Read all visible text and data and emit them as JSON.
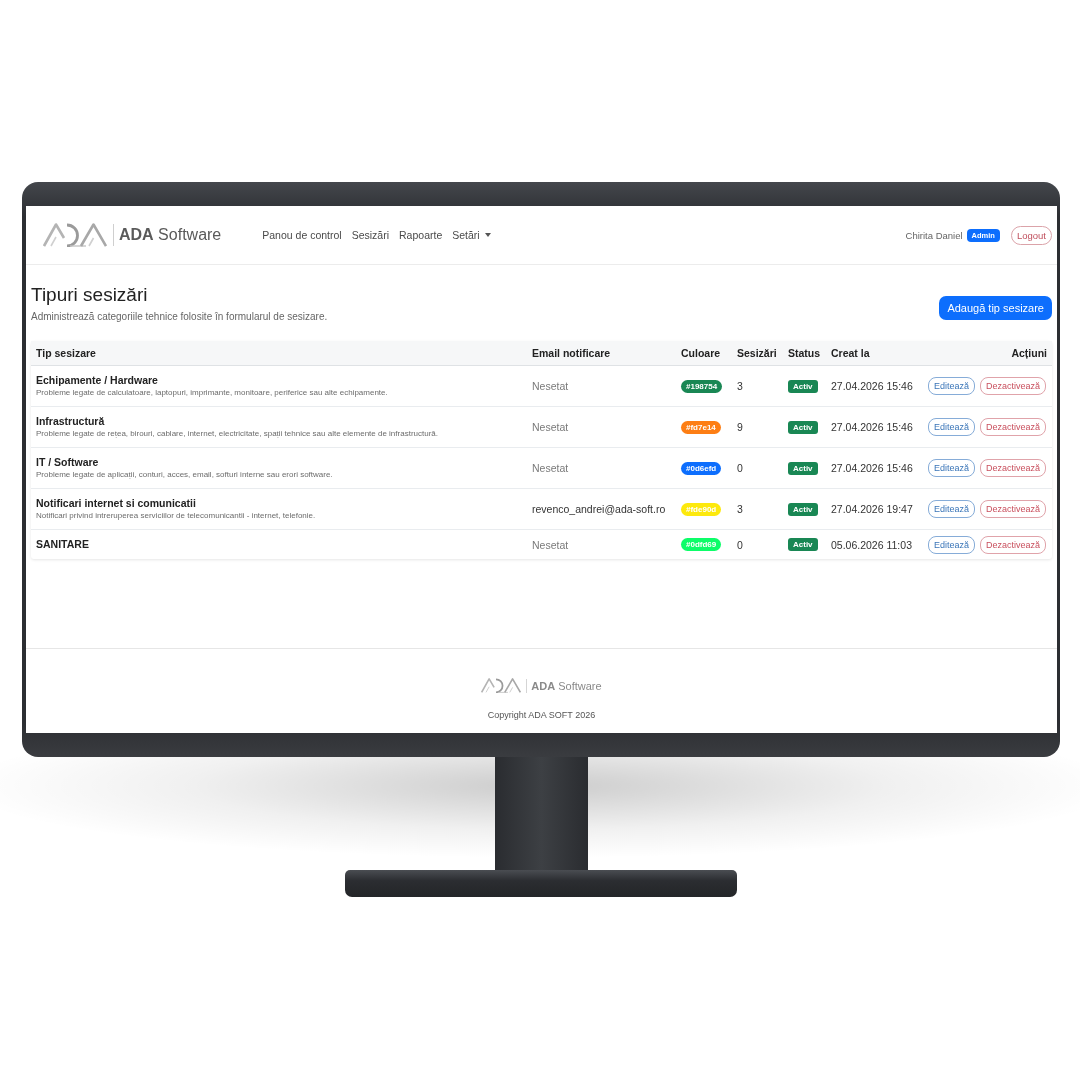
{
  "navbar": {
    "brand": "**ADA** Software",
    "links": [
      {
        "label": "Panou de control",
        "dropdown": false
      },
      {
        "label": "Sesizări",
        "dropdown": false
      },
      {
        "label": "Rapoarte",
        "dropdown": false
      },
      {
        "label": "Setări",
        "dropdown": true
      }
    ],
    "user": {
      "name": "Chirita Daniel",
      "role": "Admin"
    },
    "logout": "Logout"
  },
  "page": {
    "title": "Tipuri sesizări",
    "subtitle": "Administrează categoriile tehnice folosite în formularul de sesizare.",
    "add_button": "Adaugă tip sesizare"
  },
  "table": {
    "columns": [
      "Tip sesizare",
      "Email notificare",
      "Culoare",
      "Sesizări",
      "Status",
      "Creat la",
      "Acțiuni"
    ],
    "rows": [
      {
        "name": "Echipamente / Hardware",
        "description": "Probleme legate de calculatoare, laptopuri, imprimante, monitoare, periferice sau alte echipamente.",
        "email": "Nesetat",
        "email_set": false,
        "color": "#198754",
        "color_code": "#198754",
        "count": "3",
        "status": "Activ",
        "created": "27.04.2026 15:46",
        "actions": [
          {
            "label": "Editează",
            "kind": "edit"
          },
          {
            "label": "Dezactivează",
            "kind": "deactivate"
          }
        ]
      },
      {
        "name": "Infrastructură",
        "description": "Probleme legate de rețea, birouri, cablare, internet, electricitate, spații tehnice sau alte elemente de infrastructură.",
        "email": "Nesetat",
        "email_set": false,
        "color": "#fd7e14",
        "color_code": "#fd7e14",
        "count": "9",
        "status": "Activ",
        "created": "27.04.2026 15:46",
        "actions": [
          {
            "label": "Editează",
            "kind": "edit"
          },
          {
            "label": "Dezactivează",
            "kind": "deactivate"
          }
        ]
      },
      {
        "name": "IT / Software",
        "description": "Probleme legate de aplicații, conturi, acces, email, softuri interne sau erori software.",
        "email": "Nesetat",
        "email_set": false,
        "color": "#0d6efd",
        "color_code": "#0d6efd",
        "count": "0",
        "status": "Activ",
        "created": "27.04.2026 15:46",
        "actions": [
          {
            "label": "Editează",
            "kind": "edit"
          },
          {
            "label": "Dezactivează",
            "kind": "deactivate"
          }
        ]
      },
      {
        "name": "Notificari internet si comunicatii",
        "description": "Notificari privind intreruperea serviciilor de telecomunicantii - internet, telefonie.",
        "email": "revenco_andrei@ada-soft.ro",
        "email_set": true,
        "color": "#fde90d",
        "color_code": "#fde90d",
        "count": "3",
        "status": "Activ",
        "created": "27.04.2026 19:47",
        "actions": [
          {
            "label": "Editează",
            "kind": "edit"
          },
          {
            "label": "Dezactivează",
            "kind": "deactivate"
          }
        ]
      },
      {
        "name": "SANITARE",
        "email": "Nesetat",
        "email_set": false,
        "color": "#0dfd69",
        "color_code": "#0dfd69",
        "count": "0",
        "status": "Activ",
        "created": "05.06.2026 11:03",
        "actions": [
          {
            "label": "Editează",
            "kind": "edit"
          },
          {
            "label": "Dezactivează",
            "kind": "deactivate"
          }
        ]
      }
    ]
  },
  "footer": {
    "brand": "**ADA** Software",
    "copyright": "Copyright ADA SOFT 2026"
  }
}
